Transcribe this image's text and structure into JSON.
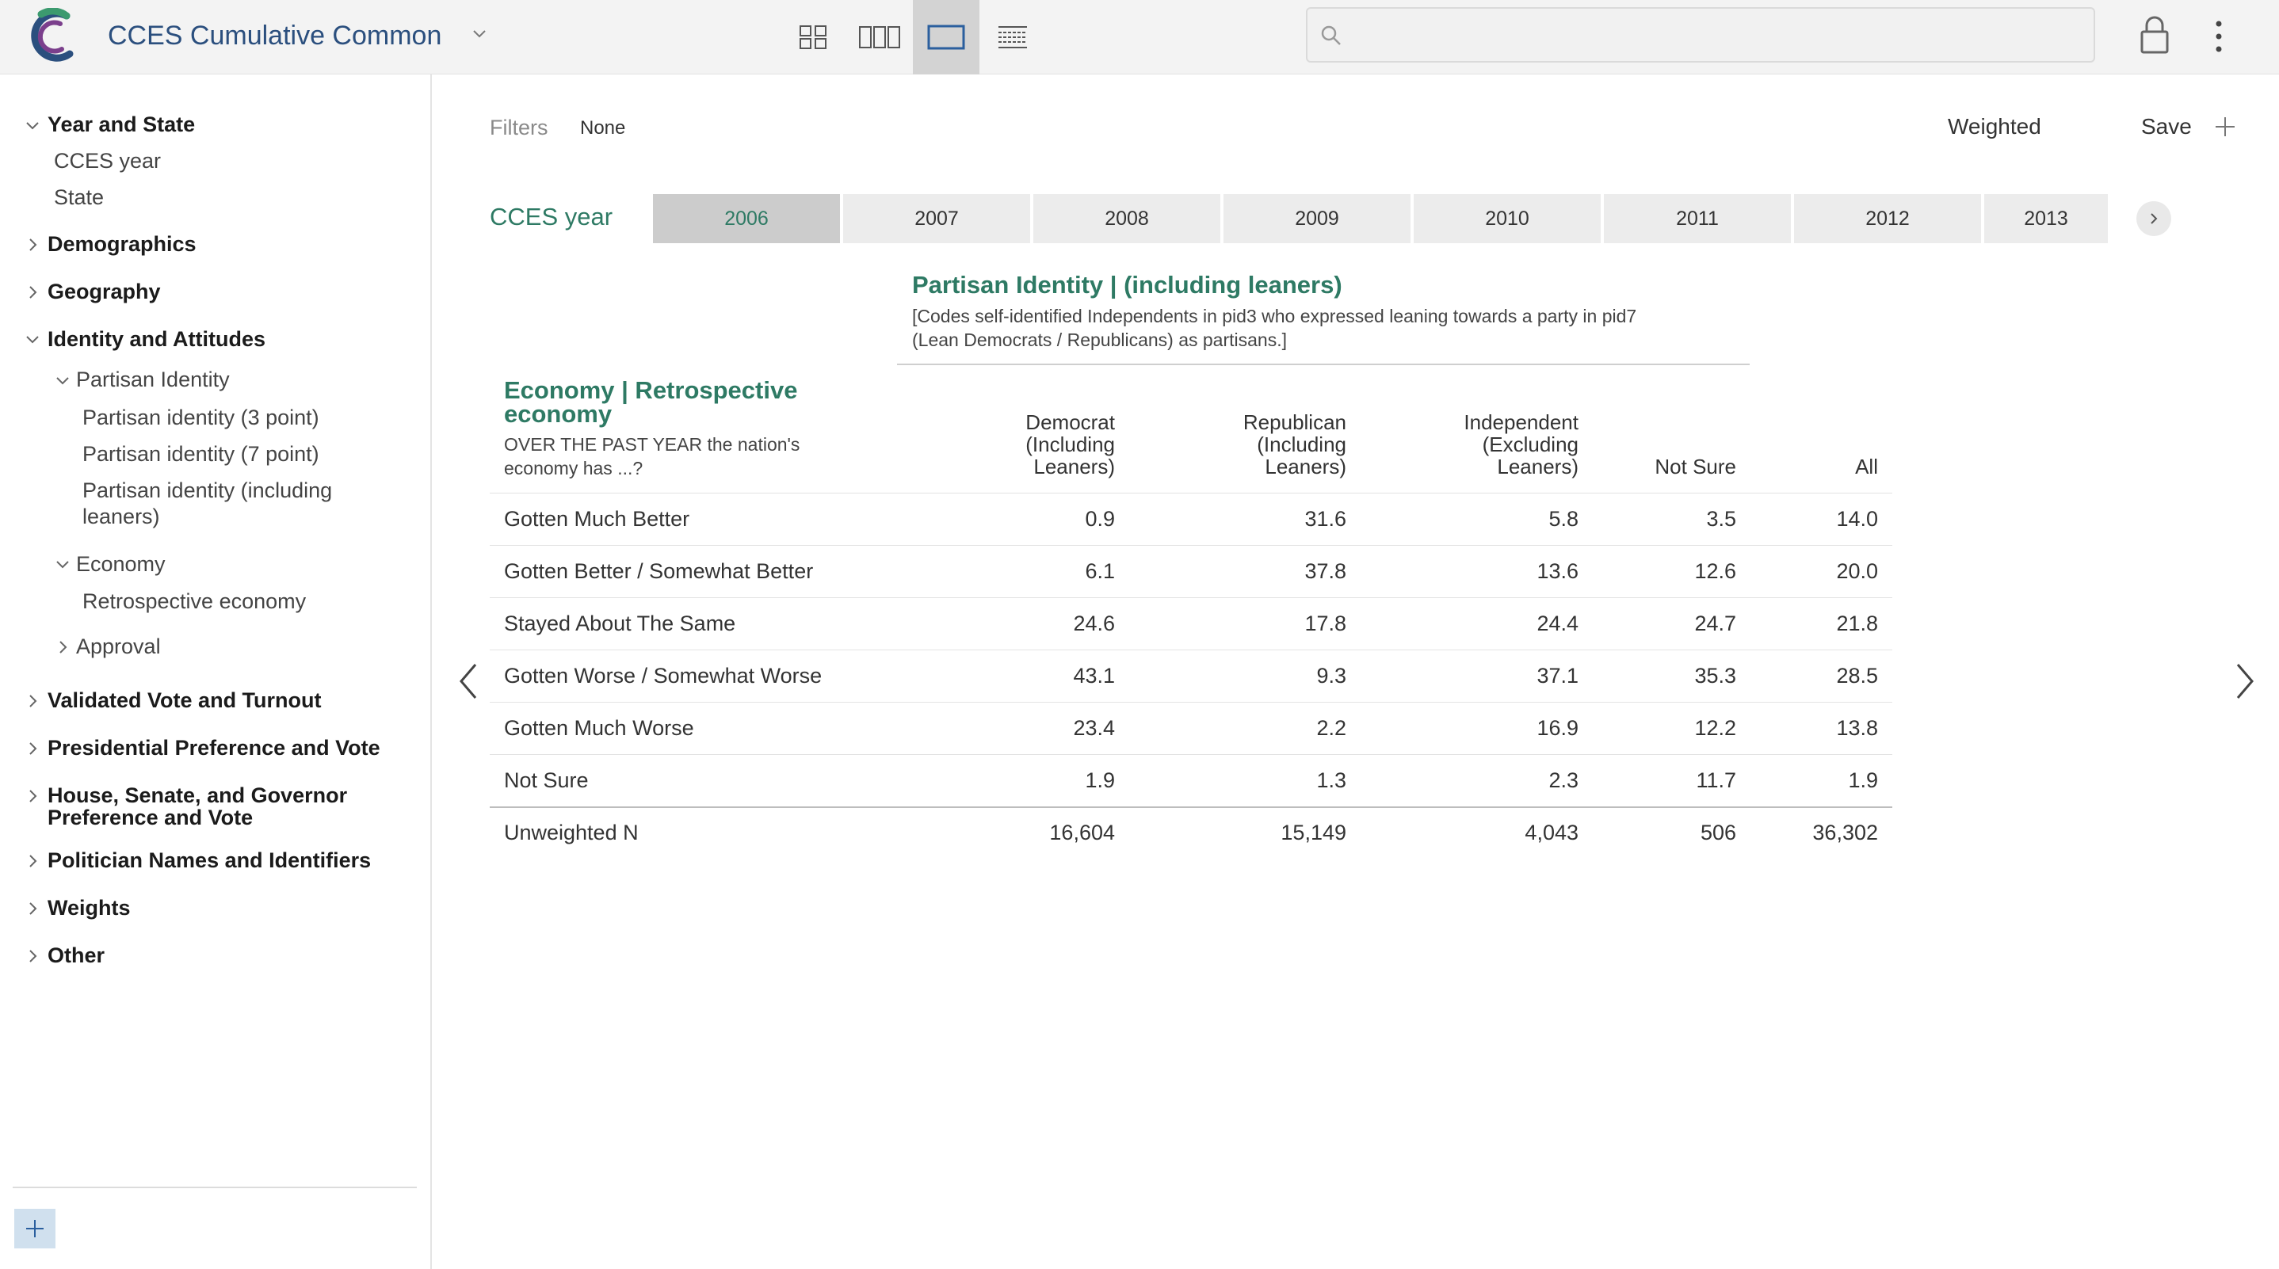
{
  "app": {
    "title": "CCES Cumulative Common"
  },
  "search": {
    "placeholder": "",
    "value": ""
  },
  "sidebar": {
    "items": [
      {
        "label": "Year and State"
      },
      {
        "label": "CCES year"
      },
      {
        "label": "State"
      },
      {
        "label": "Demographics"
      },
      {
        "label": "Geography"
      },
      {
        "label": "Identity and Attitudes"
      },
      {
        "label": "Partisan Identity"
      },
      {
        "label": "Partisan identity (3 point)"
      },
      {
        "label": "Partisan identity (7 point)"
      },
      {
        "label": "Partisan identity (including"
      },
      {
        "label": "leaners)"
      },
      {
        "label": "Economy"
      },
      {
        "label": "Retrospective economy"
      },
      {
        "label": "Approval"
      },
      {
        "label": "Validated Vote and Turnout"
      },
      {
        "label": "Presidential Preference and Vote"
      },
      {
        "label": "House, Senate, and Governor"
      },
      {
        "label": "Preference and Vote"
      },
      {
        "label": "Politician Names and Identifiers"
      },
      {
        "label": "Weights"
      },
      {
        "label": "Other"
      }
    ]
  },
  "toolbar": {
    "filters_label": "Filters",
    "filters_value": "None",
    "weighted_label": "Weighted",
    "save_label": "Save"
  },
  "year_filter": {
    "label": "CCES year",
    "years": [
      "2006",
      "2007",
      "2008",
      "2009",
      "2010",
      "2011",
      "2012",
      "2013"
    ],
    "selected": "2006"
  },
  "table": {
    "column_variable": {
      "title": "Partisan Identity | (including leaners)",
      "description_line1": "[Codes self-identified Independents in pid3 who expressed leaning towards a party in pid7",
      "description_line2": "(Lean Democrats / Republicans) as partisans.]"
    },
    "row_variable": {
      "title": "Economy | Retrospective economy",
      "description": "OVER THE PAST YEAR the nation's economy has ...?"
    },
    "columns": [
      {
        "l1": "Democrat",
        "l2": "(Including",
        "l3": "Leaners)"
      },
      {
        "l1": "Republican",
        "l2": "(Including",
        "l3": "Leaners)"
      },
      {
        "l1": "Independent",
        "l2": "(Excluding",
        "l3": "Leaners)"
      },
      {
        "l1": "",
        "l2": "",
        "l3": "Not Sure"
      },
      {
        "l1": "",
        "l2": "",
        "l3": "All"
      }
    ],
    "rows": [
      {
        "label": "Gotten Much Better",
        "values": [
          "0.9",
          "31.6",
          "5.8",
          "3.5",
          "14.0"
        ]
      },
      {
        "label": "Gotten Better / Somewhat Better",
        "values": [
          "6.1",
          "37.8",
          "13.6",
          "12.6",
          "20.0"
        ]
      },
      {
        "label": "Stayed About The Same",
        "values": [
          "24.6",
          "17.8",
          "24.4",
          "24.7",
          "21.8"
        ]
      },
      {
        "label": "Gotten Worse / Somewhat Worse",
        "values": [
          "43.1",
          "9.3",
          "37.1",
          "35.3",
          "28.5"
        ]
      },
      {
        "label": "Gotten Much Worse",
        "values": [
          "23.4",
          "2.2",
          "16.9",
          "12.2",
          "13.8"
        ]
      },
      {
        "label": "Not Sure",
        "values": [
          "1.9",
          "1.3",
          "2.3",
          "11.7",
          "1.9"
        ]
      }
    ],
    "total_row": {
      "label": "Unweighted N",
      "values": [
        "16,604",
        "15,149",
        "4,043",
        "506",
        "36,302"
      ]
    }
  },
  "colors": {
    "accent_green": "#2e7a64",
    "title_blue": "#2b4f7e",
    "active_tab": "#cccccc"
  },
  "icons": {
    "logo": "cces-logo",
    "grid": "grid-view-icon",
    "columns": "columns-view-icon",
    "single": "single-view-icon",
    "list": "list-view-icon",
    "search": "search-icon",
    "lock": "lock-icon",
    "more": "more-vertical-icon"
  }
}
